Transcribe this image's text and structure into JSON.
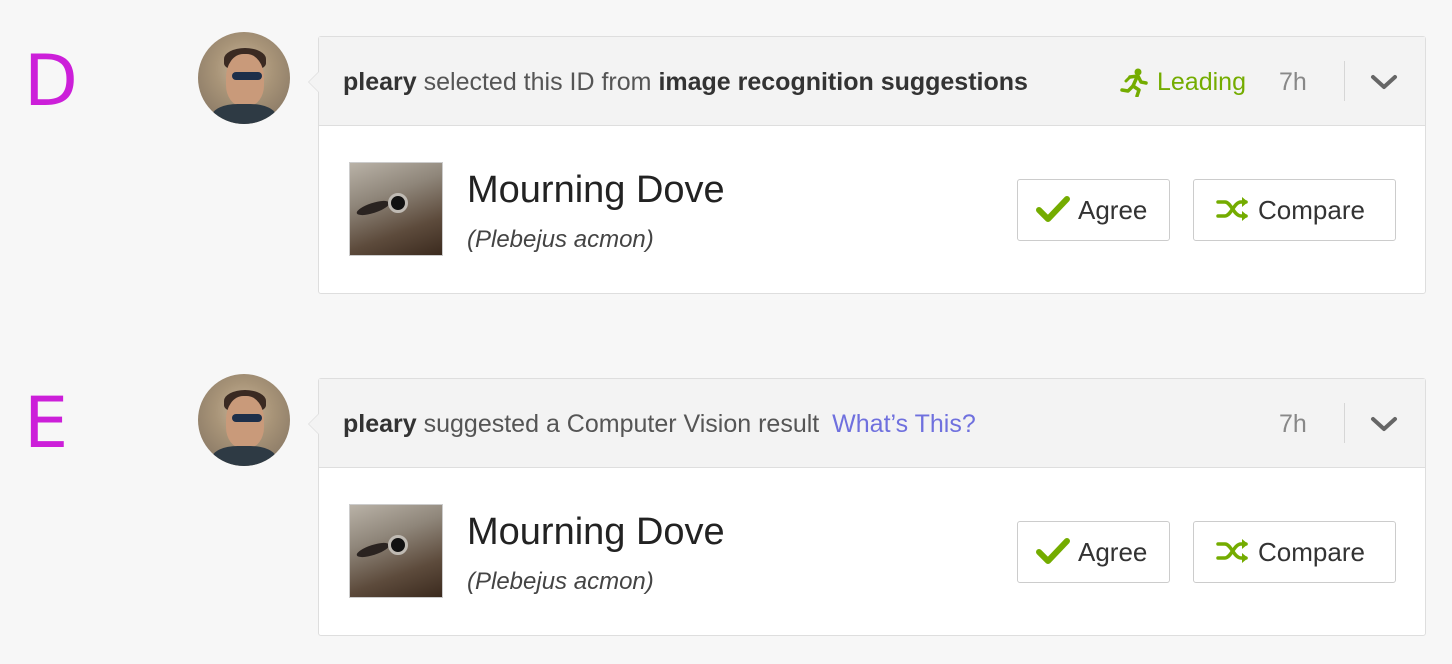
{
  "identifications": [
    {
      "variant_label": "D",
      "user": "pleary",
      "action_text": "selected this ID from",
      "source_text": "image recognition suggestions",
      "status": "Leading",
      "time": "7h",
      "taxon": {
        "common_name": "Mourning Dove",
        "scientific_name": "(Plebejus acmon)"
      },
      "buttons": {
        "agree": "Agree",
        "compare": "Compare"
      }
    },
    {
      "variant_label": "E",
      "user": "pleary",
      "action_text": "suggested a Computer Vision result",
      "link_text": "What’s This?",
      "time": "7h",
      "taxon": {
        "common_name": "Mourning Dove",
        "scientific_name": "(Plebejus acmon)"
      },
      "buttons": {
        "agree": "Agree",
        "compare": "Compare"
      }
    }
  ],
  "colors": {
    "variant_label": "#cc1fd9",
    "leading": "#74ac00",
    "link": "#6f70de",
    "check": "#74ac00"
  },
  "icons": [
    "running-person-icon",
    "chevron-down-icon",
    "checkmark-icon",
    "shuffle-icon"
  ]
}
